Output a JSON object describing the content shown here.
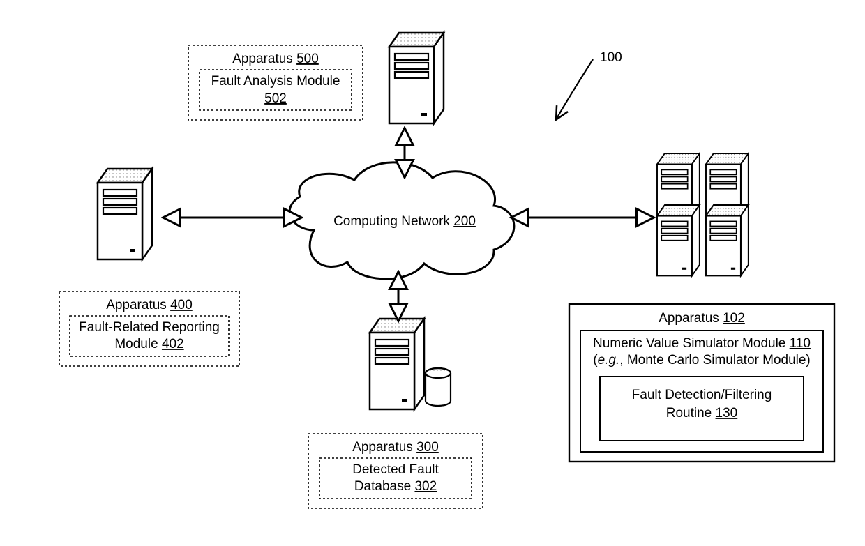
{
  "figure_ref": "100",
  "network": {
    "label_prefix": "Computing Network",
    "ref": "200"
  },
  "apparatus500": {
    "title_prefix": "Apparatus",
    "ref": "500",
    "module": {
      "line1": "Fault Analysis Module",
      "ref": "502"
    }
  },
  "apparatus400": {
    "title_prefix": "Apparatus",
    "ref": "400",
    "module": {
      "line1": "Fault-Related Reporting",
      "line2_prefix": "Module",
      "ref": "402"
    }
  },
  "apparatus300": {
    "title_prefix": "Apparatus",
    "ref": "300",
    "module": {
      "line1": "Detected Fault",
      "line2_prefix": "Database",
      "ref": "302"
    }
  },
  "apparatus102": {
    "title_prefix": "Apparatus",
    "ref": "102",
    "module": {
      "line1_prefix": "Numeric Value Simulator Module",
      "line1_ref": "110",
      "line2": "(e.g., Monte Carlo Simulator Module)",
      "routine": {
        "line1": "Fault Detection/Filtering",
        "line2_prefix": "Routine",
        "ref": "130"
      }
    }
  }
}
